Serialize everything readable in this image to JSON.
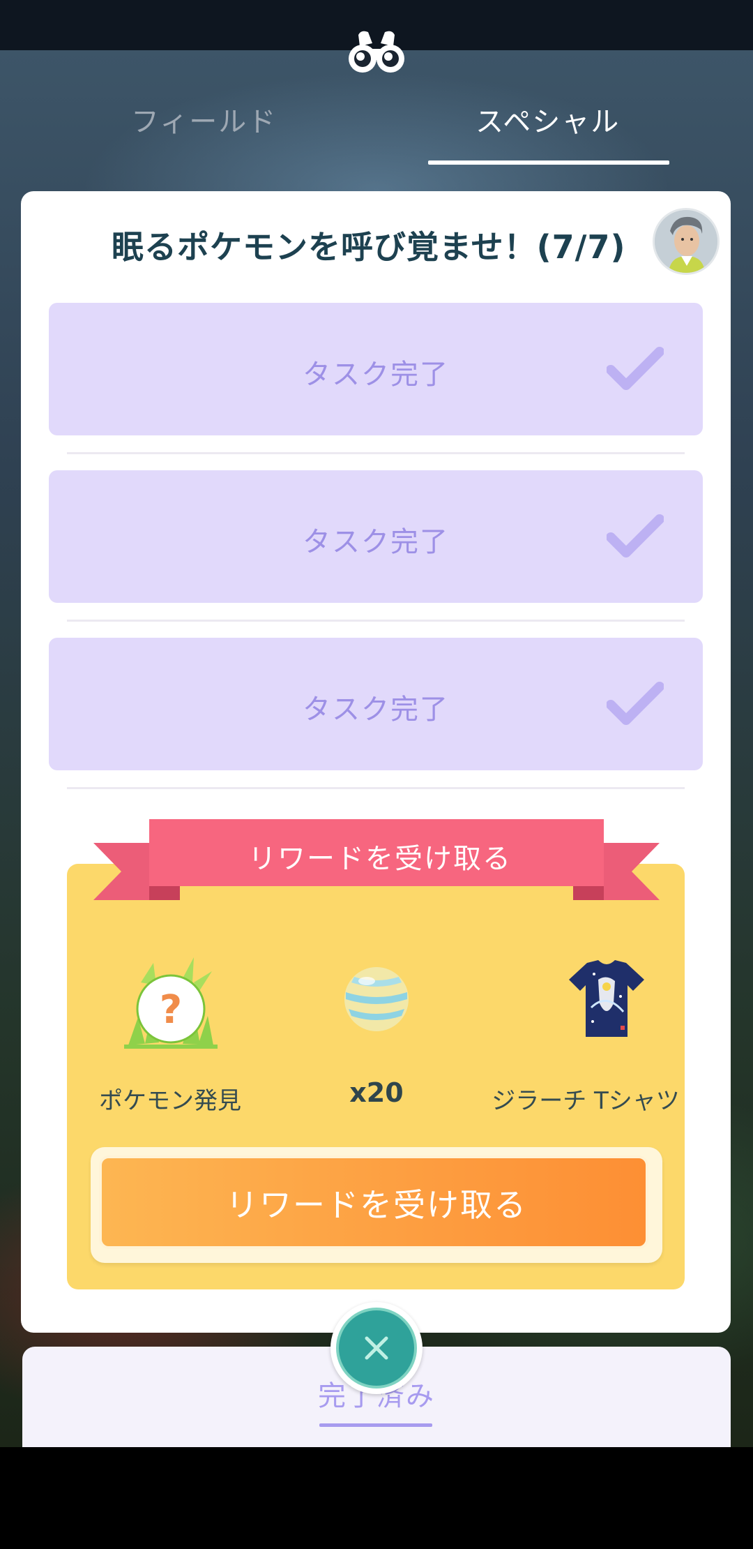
{
  "tabs": {
    "field_label": "フィールド",
    "special_label": "スペシャル",
    "active": "special"
  },
  "research": {
    "title": "眠るポケモンを呼び覚ませ！(7/7)",
    "tasks": [
      {
        "label": "タスク完了"
      },
      {
        "label": "タスク完了"
      },
      {
        "label": "タスク完了"
      }
    ]
  },
  "rewards": {
    "ribbon_label": "リワードを受け取る",
    "items": [
      {
        "icon": "pokemon-encounter-icon",
        "label": "ポケモン発見"
      },
      {
        "icon": "rare-candy-icon",
        "label": "x20"
      },
      {
        "icon": "jirachi-tshirt-icon",
        "label": "ジラーチ Tシャツ"
      }
    ],
    "claim_button_label": "リワードを受け取る"
  },
  "bottom": {
    "completed_label": "完了済み"
  },
  "colors": {
    "task_bg": "#e1d9fb",
    "task_text": "#9d90e6",
    "reward_bg": "#fcd86a",
    "ribbon": "#f7667f",
    "claim_button": "#fd9d40",
    "close_button": "#2fa29a"
  }
}
